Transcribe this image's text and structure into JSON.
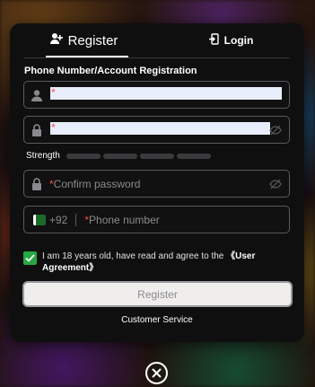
{
  "tabs": {
    "register_label": "Register",
    "login_label": "Login"
  },
  "form": {
    "section_title": "Phone Number/Account Registration",
    "account_value": "",
    "password_value": "",
    "required_mark": "*",
    "strength_label": "Strength",
    "strength_level": 0,
    "confirm_placeholder": "Confirm password",
    "country_code": "+92",
    "phone_placeholder": "Phone number"
  },
  "agreement": {
    "checked": true,
    "text": "I am 18 years old, have read and agree to the ",
    "link": "《User Agreement》"
  },
  "register_button_label": "Register",
  "customer_service_label": "Customer Service",
  "colors": {
    "accent_green": "#27a844",
    "required_red": "#ff4a4a",
    "modal_bg": "#0f0f10"
  },
  "icons": [
    "user-plus-icon",
    "login-icon",
    "user-icon",
    "lock-icon",
    "eye-off-icon",
    "pakistan-flag-icon",
    "check-icon",
    "close-icon"
  ]
}
